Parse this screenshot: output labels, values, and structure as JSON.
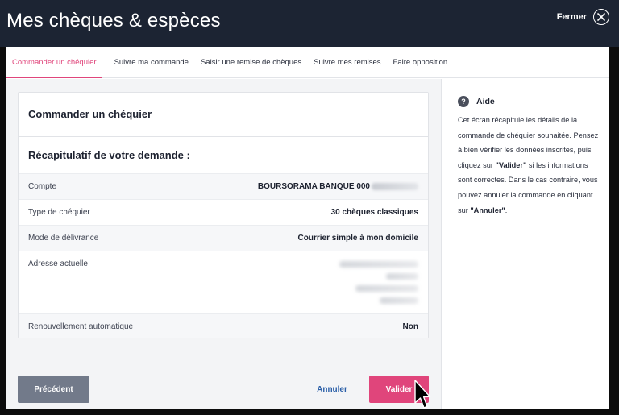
{
  "header": {
    "title": "Mes chèques & espèces",
    "close_label": "Fermer"
  },
  "tabs": [
    {
      "label": "Commander un chéquier",
      "active": true
    },
    {
      "label": "Suivre ma commande",
      "active": false
    },
    {
      "label": "Saisir une remise de chèques",
      "active": false
    },
    {
      "label": "Suivre mes remises",
      "active": false
    },
    {
      "label": "Faire opposition",
      "active": false
    }
  ],
  "card": {
    "title": "Commander un chéquier",
    "subtitle": "Récapitulatif de votre demande :",
    "rows": {
      "account": {
        "label": "Compte",
        "value": "BOURSORAMA BANQUE 000"
      },
      "type": {
        "label": "Type de chéquier",
        "value": "30 chèques classiques"
      },
      "delivery": {
        "label": "Mode de délivrance",
        "value": "Courrier simple à mon domicile"
      },
      "address": {
        "label": "Adresse actuelle"
      },
      "renewal": {
        "label": "Renouvellement automatique",
        "value": "Non"
      }
    }
  },
  "buttons": {
    "previous": "Précédent",
    "cancel": "Annuler",
    "validate": "Valider"
  },
  "help": {
    "title": "Aide",
    "text_1": "Cet écran récapitule les détails de la commande de chéquier souhaitée. Pensez à bien vérifier les données inscrites, puis cliquez sur ",
    "quote_validate": "\"Valider\"",
    "text_2": " si les informations sont correctes. Dans le cas contraire, vous pouvez annuler la commande en cliquant sur ",
    "quote_cancel": "\"Annuler\"",
    "text_3": "."
  },
  "colors": {
    "accent": "#e0457b",
    "header_bg": "#1c2433",
    "link": "#2b5fa8",
    "secondary_button": "#727a8a"
  },
  "icons": {
    "close": "close-icon",
    "help": "question-circle-icon",
    "cursor": "mouse-pointer-icon"
  }
}
